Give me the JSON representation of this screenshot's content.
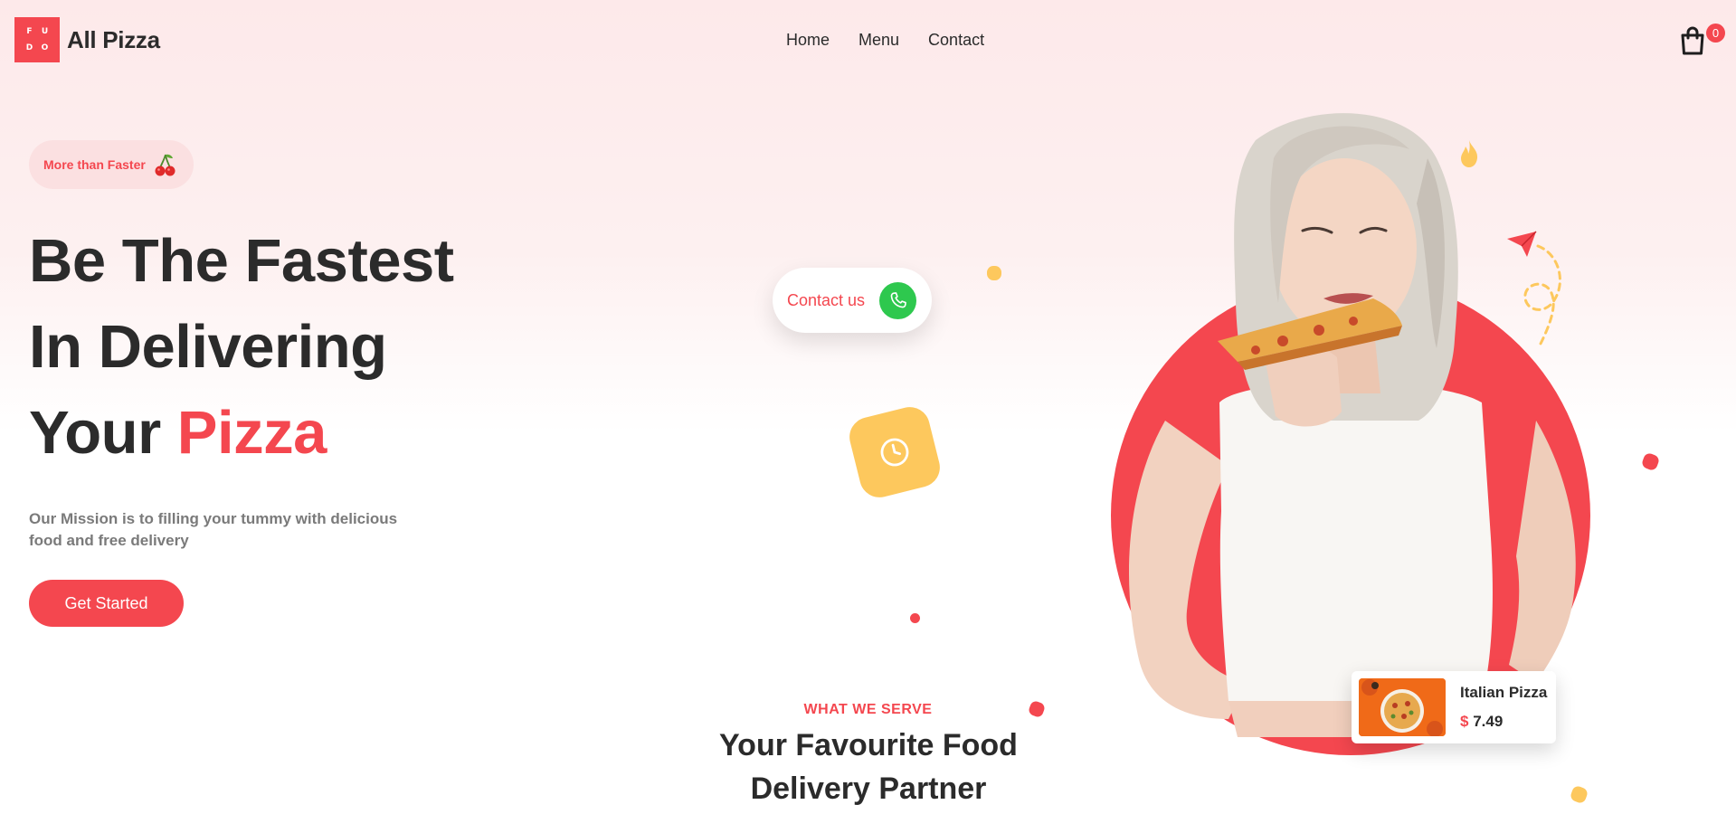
{
  "header": {
    "logo_letters": [
      "F",
      "U",
      "D",
      "O"
    ],
    "brand": "All Pizza",
    "nav": [
      {
        "label": "Home"
      },
      {
        "label": "Menu"
      },
      {
        "label": "Contact"
      }
    ],
    "cart_count": "0"
  },
  "hero": {
    "badge": "More than Faster",
    "badge_icon": "cherry-icon",
    "line1": "Be The Fastest",
    "line2": "In Delivering",
    "line3_prefix": "Your",
    "line3_accent": "Pizza",
    "mission": "Our Mission is to filling your tummy with delicious food and free delivery",
    "cta": "Get Started"
  },
  "contact": {
    "label": "Contact us",
    "icon": "phone-icon"
  },
  "section": {
    "tag": "WHAT WE SERVE",
    "title": "Your Favourite Food Delivery Partner"
  },
  "food_card": {
    "name": "Italian Pizza",
    "currency": "$",
    "price": "7.49"
  },
  "colors": {
    "accent": "#f4474f",
    "yellow": "#fdc85d",
    "green": "#2ec84e",
    "dark": "#2b2b2b"
  }
}
